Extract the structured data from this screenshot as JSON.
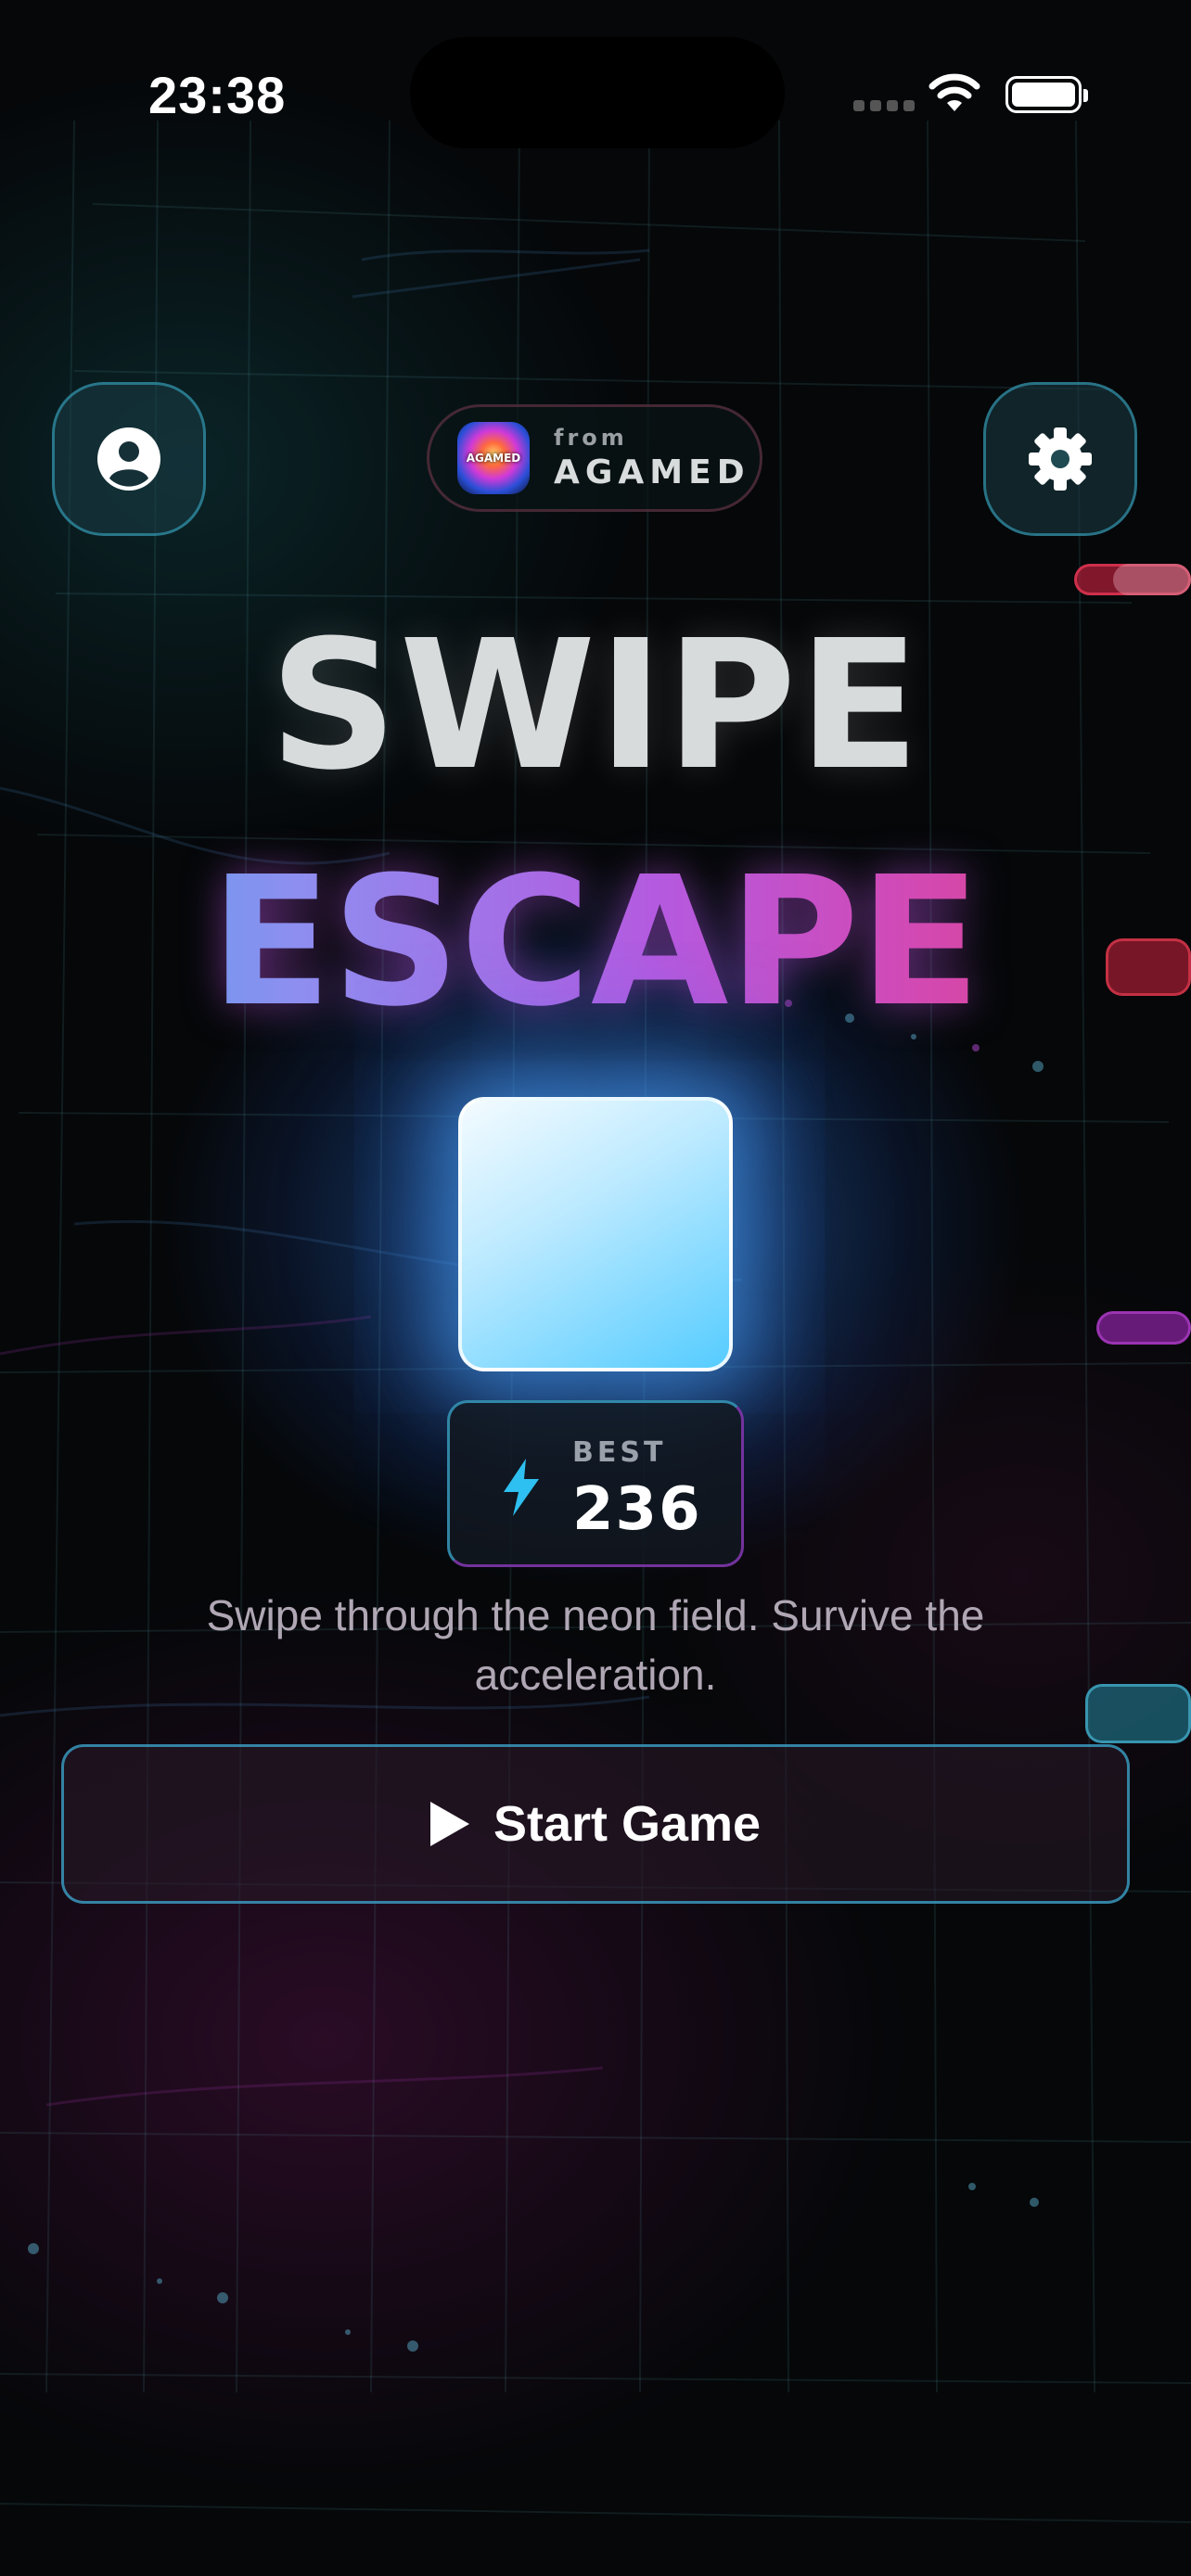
{
  "status_bar": {
    "time": "23:38"
  },
  "header": {
    "profile_icon": "person-circle-icon",
    "settings_icon": "gear-icon",
    "brand": {
      "from": "from",
      "name": "AGAMED",
      "logo_text": "AGAMED"
    }
  },
  "title": {
    "line1": "SWIPE",
    "line2": "ESCAPE"
  },
  "best": {
    "label": "BEST",
    "value": "236",
    "icon": "lightning-bolt-icon"
  },
  "tagline": "Swipe through the neon field. Survive the acceleration.",
  "start_button": {
    "label": "Start Game",
    "icon": "play-icon"
  },
  "colors": {
    "accent_cyan": "#3cb0d8",
    "title_gradient": [
      "#46a8e8",
      "#b45ae0",
      "#e5407a"
    ],
    "player_block": "#55ccff",
    "obstacle_red": "#b02a3a",
    "obstacle_purple": "#8a2a9a",
    "obstacle_teal": "#2a7e8c"
  }
}
